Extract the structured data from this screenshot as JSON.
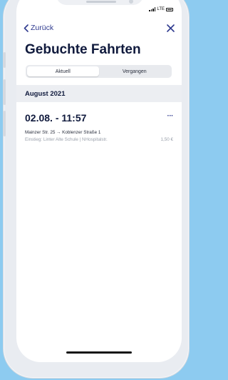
{
  "status_bar": {
    "network": "LTE"
  },
  "nav": {
    "back_label": "Zurück",
    "back_icon": "chevron-left-icon",
    "close_icon": "close-icon"
  },
  "page": {
    "title": "Gebuchte Fahrten"
  },
  "tabs": [
    {
      "label": "Aktuell",
      "active": true
    },
    {
      "label": "Vergangen",
      "active": false
    }
  ],
  "sections": [
    {
      "header": "August 2021",
      "trips": [
        {
          "datetime": "02.08. - 11:57",
          "route": "Mainzer Str. 25 → Koblenzer Straße 1",
          "detail": "Einstieg: Linter Alte Schule | NHospitalstr.",
          "price": "1,50 €",
          "more_label": "···"
        }
      ]
    }
  ],
  "colors": {
    "background": "#8dcbf0",
    "accent": "#2f3a8f",
    "title": "#101a3d",
    "section_bg": "#eceef2",
    "muted_text": "#9aa0ab"
  }
}
